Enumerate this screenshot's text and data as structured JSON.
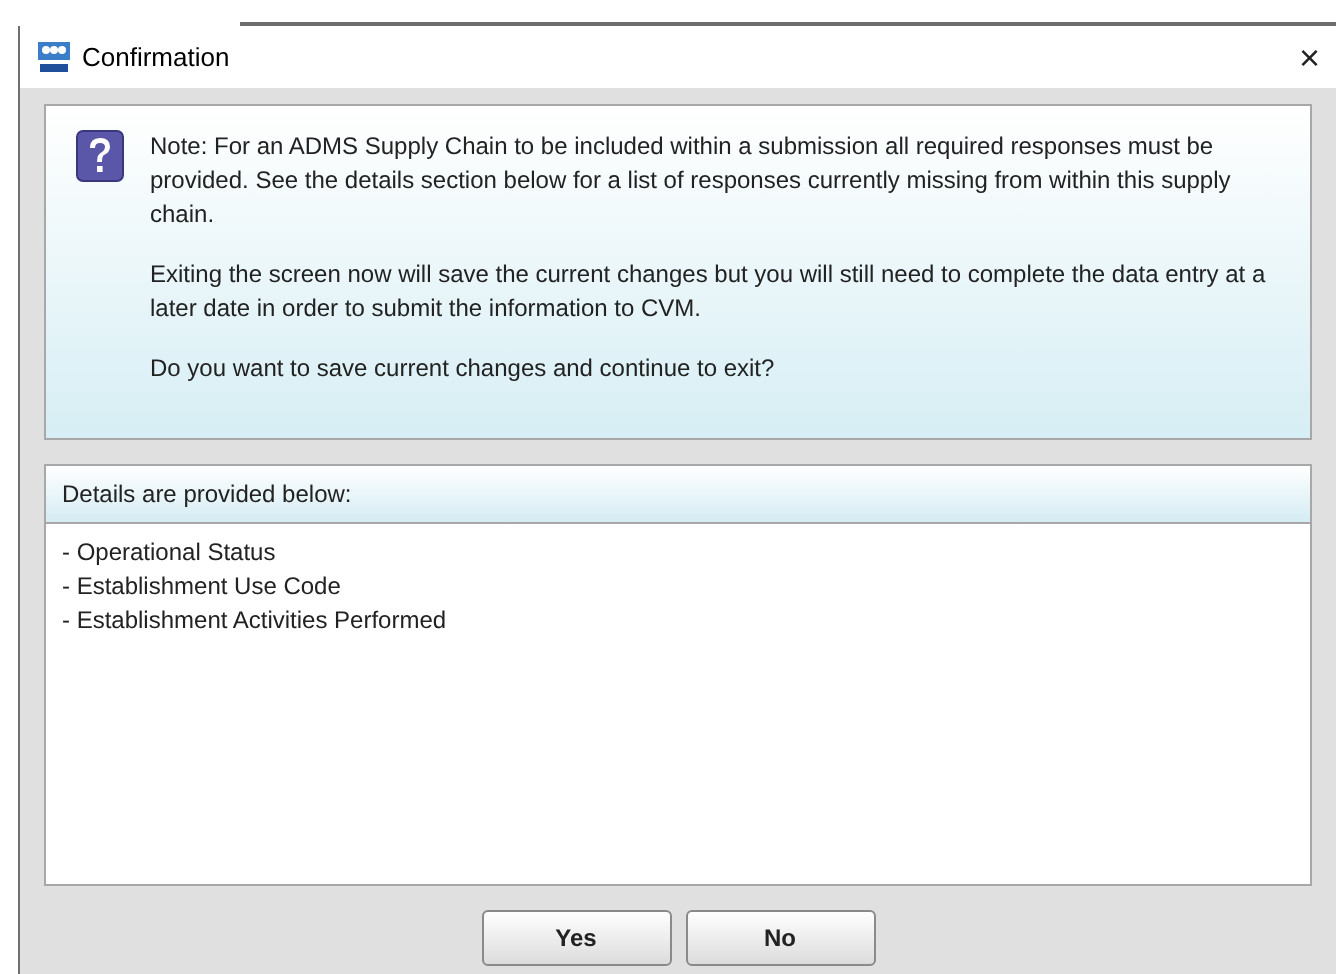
{
  "window": {
    "title": "Confirmation",
    "close": "×"
  },
  "message": {
    "paragraphs": [
      "Note: For an ADMS Supply Chain to be included within a submission all required responses must be provided. See the details section below for a list of responses currently missing from within this supply chain.",
      "Exiting the screen now will save the current changes but you will still need to complete the data entry at a later date in order to submit the information to CVM.",
      "Do you want to save current changes and continue to exit?"
    ]
  },
  "details": {
    "header": "Details are provided below:",
    "items": [
      "- Operational Status",
      "- Establishment Use Code",
      "- Establishment Activities Performed"
    ]
  },
  "buttons": [
    "Yes",
    "No"
  ]
}
